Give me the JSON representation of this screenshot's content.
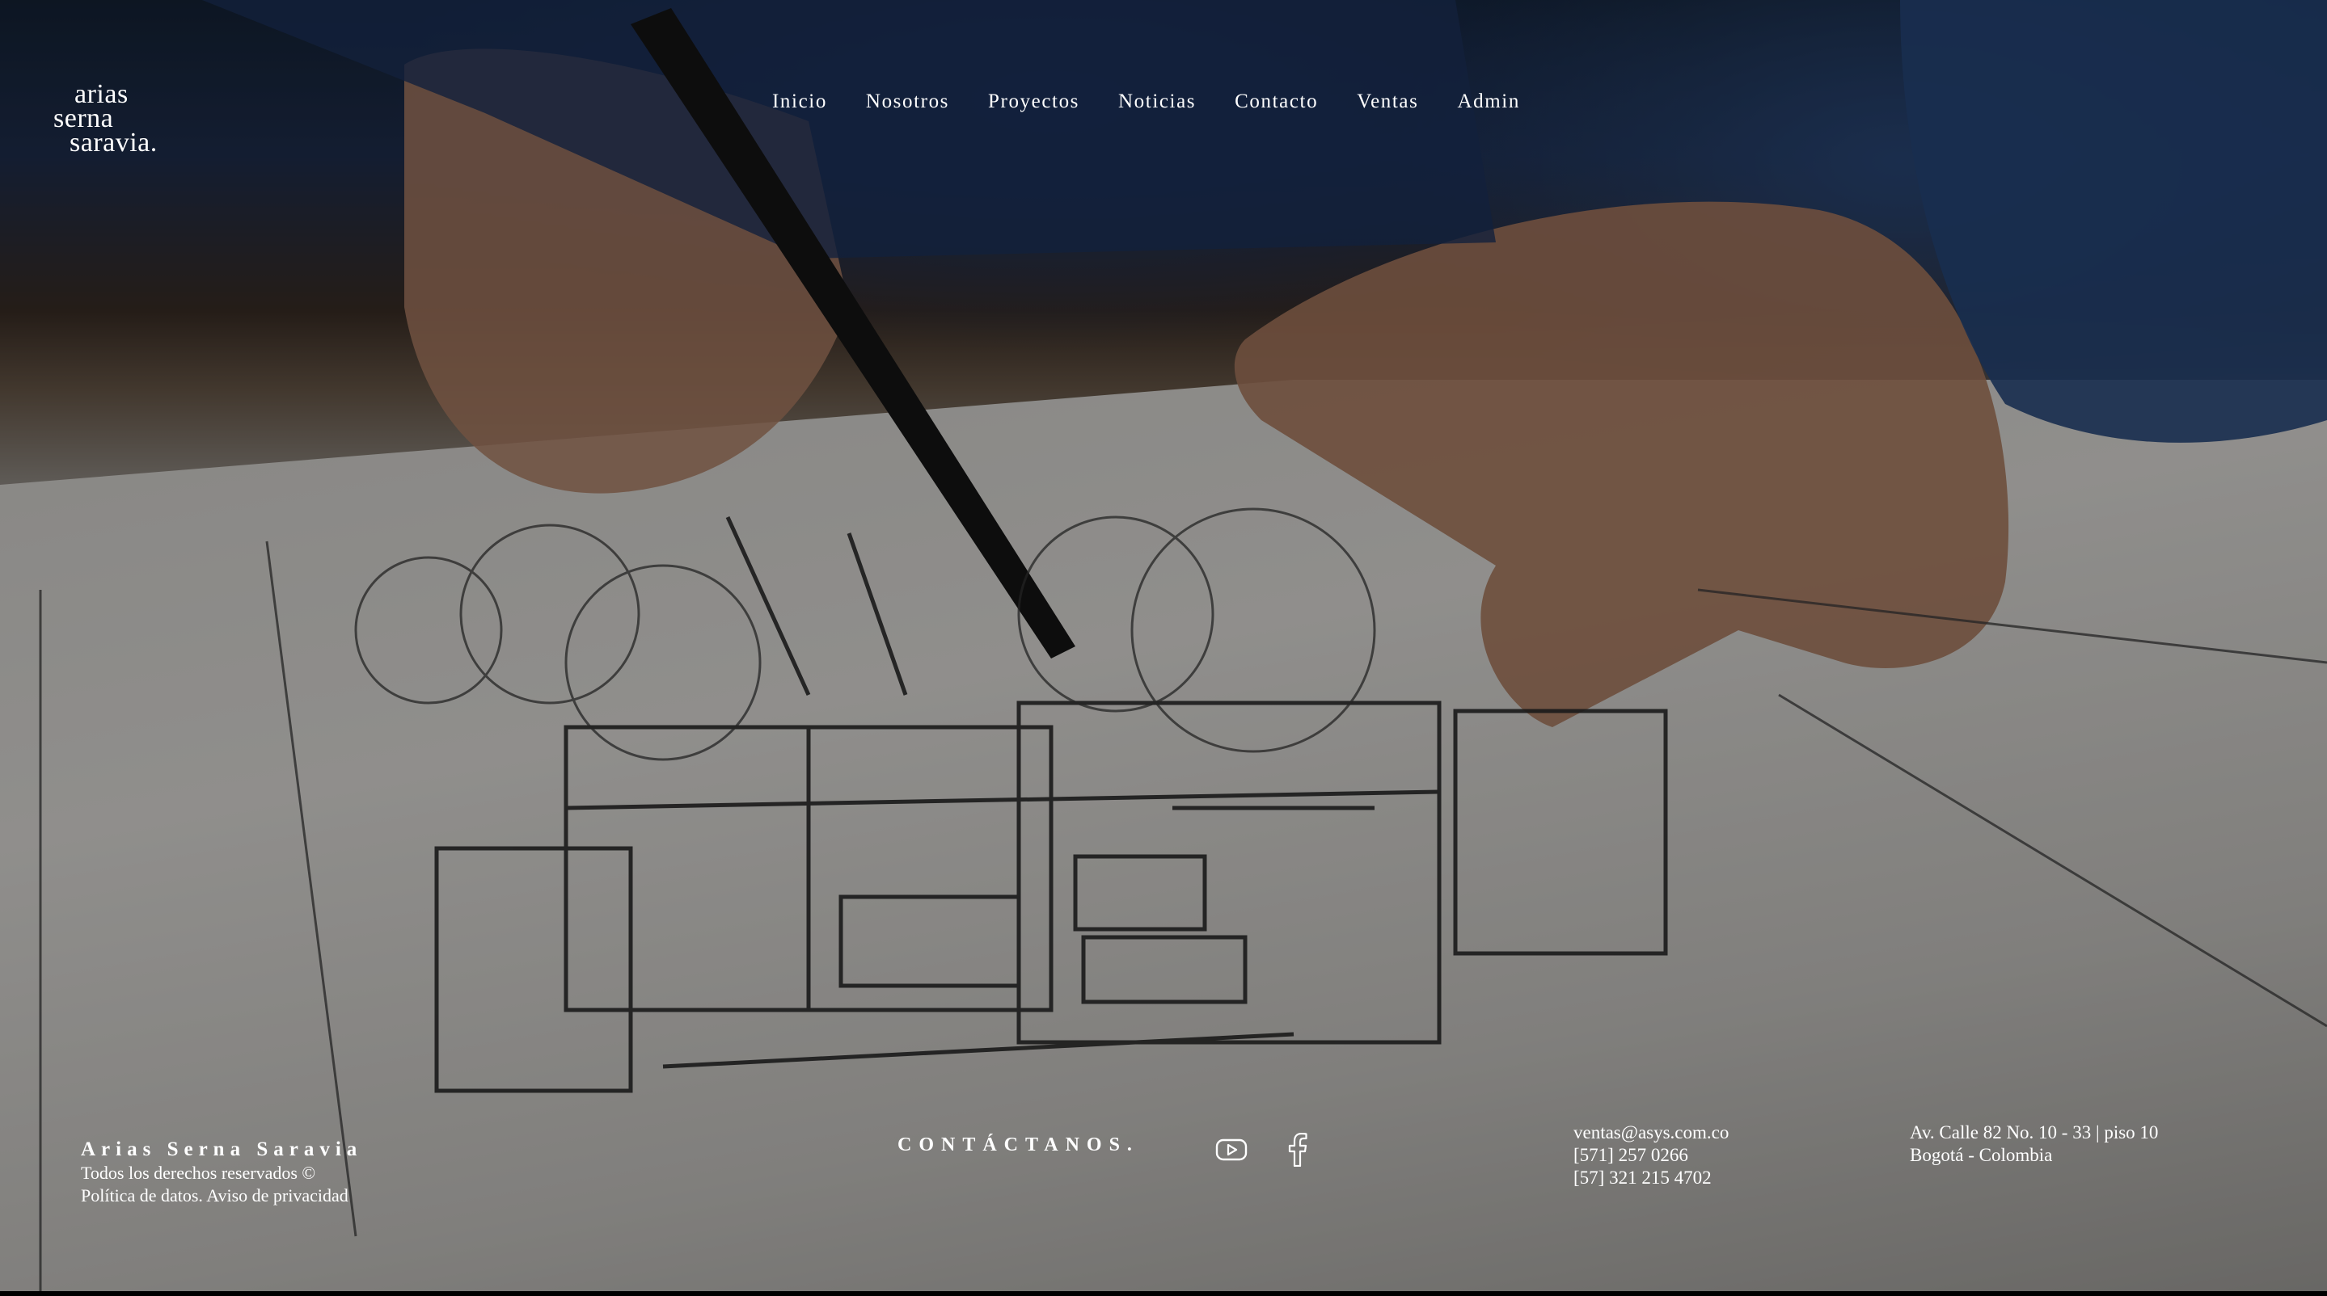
{
  "logo": {
    "line1": "arias",
    "line2": "serna",
    "line3": "saravia."
  },
  "nav": {
    "items": [
      {
        "label": "Inicio"
      },
      {
        "label": "Nosotros"
      },
      {
        "label": "Proyectos"
      },
      {
        "label": "Noticias"
      },
      {
        "label": "Contacto"
      },
      {
        "label": "Ventas"
      },
      {
        "label": "Admin"
      }
    ]
  },
  "footer": {
    "company_name": "Arias Serna Saravia",
    "rights": "Todos los derechos reservados ©",
    "policy": "Política de datos. Aviso de privacidad",
    "contact_title": "CONTÁCTANOS.",
    "social": [
      {
        "icon": "youtube-icon"
      },
      {
        "icon": "facebook-icon"
      }
    ],
    "email": "ventas@asys.com.co",
    "phone1": "[571] 257 0266",
    "phone2": "[57] 321 215 4702",
    "address_line1": "Av. Calle 82 No. 10 - 33 | piso 10",
    "address_line2": "Bogotá - Colombia"
  }
}
